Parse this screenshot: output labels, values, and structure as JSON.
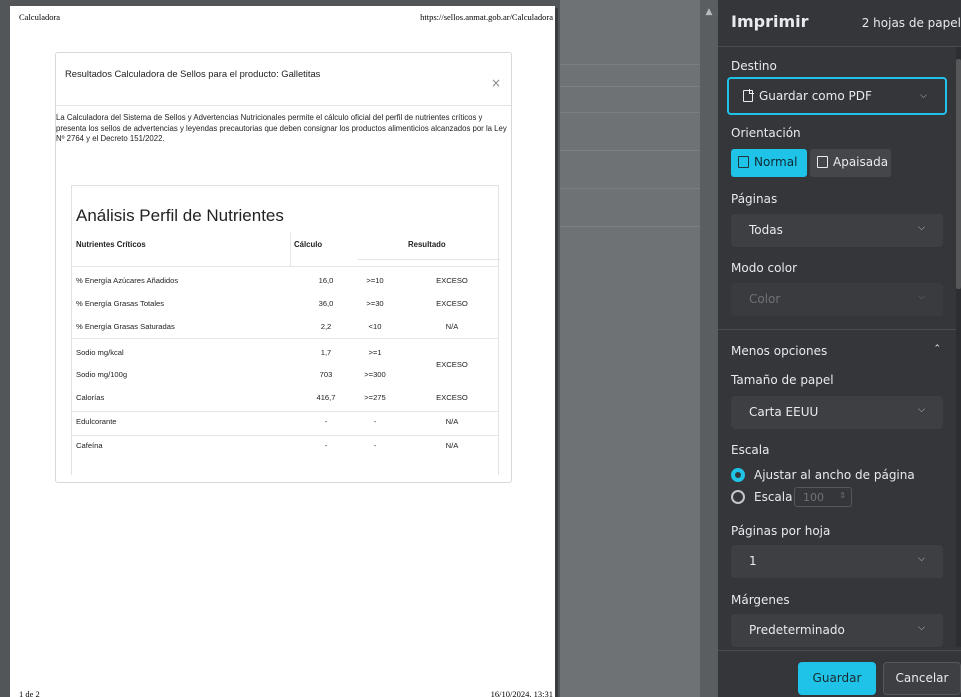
{
  "preview": {
    "header_left": "Calculadora",
    "header_right": "https://sellos.anmat.gob.ar/Calculadora",
    "footer_left": "1 de 2",
    "footer_right": "16/10/2024, 13:31",
    "modal": {
      "title": "Resultados Calculadora de Sellos para el producto: Galletitas",
      "close_glyph": "×",
      "description": "La Calculadora del Sistema de Sellos y Advertencias Nutricionales permite el cálculo oficial del perfil de nutrientes críticos y presenta los sellos de advertencias y leyendas precautorias que deben consignar los productos alimenticios alcanzados por la Ley Nº 2764 y el Decreto 151/2022.",
      "card_title": "Análisis Perfil de Nutrientes",
      "columns": {
        "nutrient": "Nutrientes Críticos",
        "calc": "Cálculo",
        "result": "Resultado"
      },
      "rows": [
        {
          "name": "% Energía Azúcares Añadidos",
          "calc": "16,0",
          "threshold": ">=10",
          "result": "EXCESO"
        },
        {
          "name": "% Energía Grasas Totales",
          "calc": "36,0",
          "threshold": ">=30",
          "result": "EXCESO"
        },
        {
          "name": "% Energía Grasas Saturadas",
          "calc": "2,2",
          "threshold": "<10",
          "result": "N/A"
        },
        {
          "name": "Sodio mg/kcal",
          "calc": "1,7",
          "threshold": ">=1",
          "result": ""
        },
        {
          "name": "Sodio mg/100g",
          "calc": "703",
          "threshold": ">=300",
          "result": ""
        },
        {
          "name": "Calorías",
          "calc": "416,7",
          "threshold": ">=275",
          "result": "EXCESO"
        },
        {
          "name": "Edulcorante",
          "calc": "-",
          "threshold": "-",
          "result": "N/A"
        },
        {
          "name": "Cafeína",
          "calc": "-",
          "threshold": "-",
          "result": "N/A"
        }
      ],
      "sodium_merged_result": "EXCESO"
    }
  },
  "panel": {
    "title": "Imprimir",
    "sheets": "2 hojas de papel",
    "destination": {
      "label": "Destino",
      "value": "Guardar como PDF"
    },
    "orientation": {
      "label": "Orientación",
      "portrait": "Normal",
      "landscape": "Apaisada"
    },
    "pages": {
      "label": "Páginas",
      "value": "Todas"
    },
    "color": {
      "label": "Modo color",
      "value": "Color"
    },
    "less_options": "Menos opciones",
    "paper_size": {
      "label": "Tamaño de papel",
      "value": "Carta EEUU"
    },
    "scale": {
      "label": "Escala",
      "fit_option": "Ajustar al ancho de página",
      "custom_option": "Escala",
      "custom_value": "100"
    },
    "pages_per_sheet": {
      "label": "Páginas por hoja",
      "value": "1"
    },
    "margins": {
      "label": "Márgenes",
      "value": "Predeterminado"
    },
    "save_button": "Guardar",
    "cancel_button": "Cancelar"
  }
}
